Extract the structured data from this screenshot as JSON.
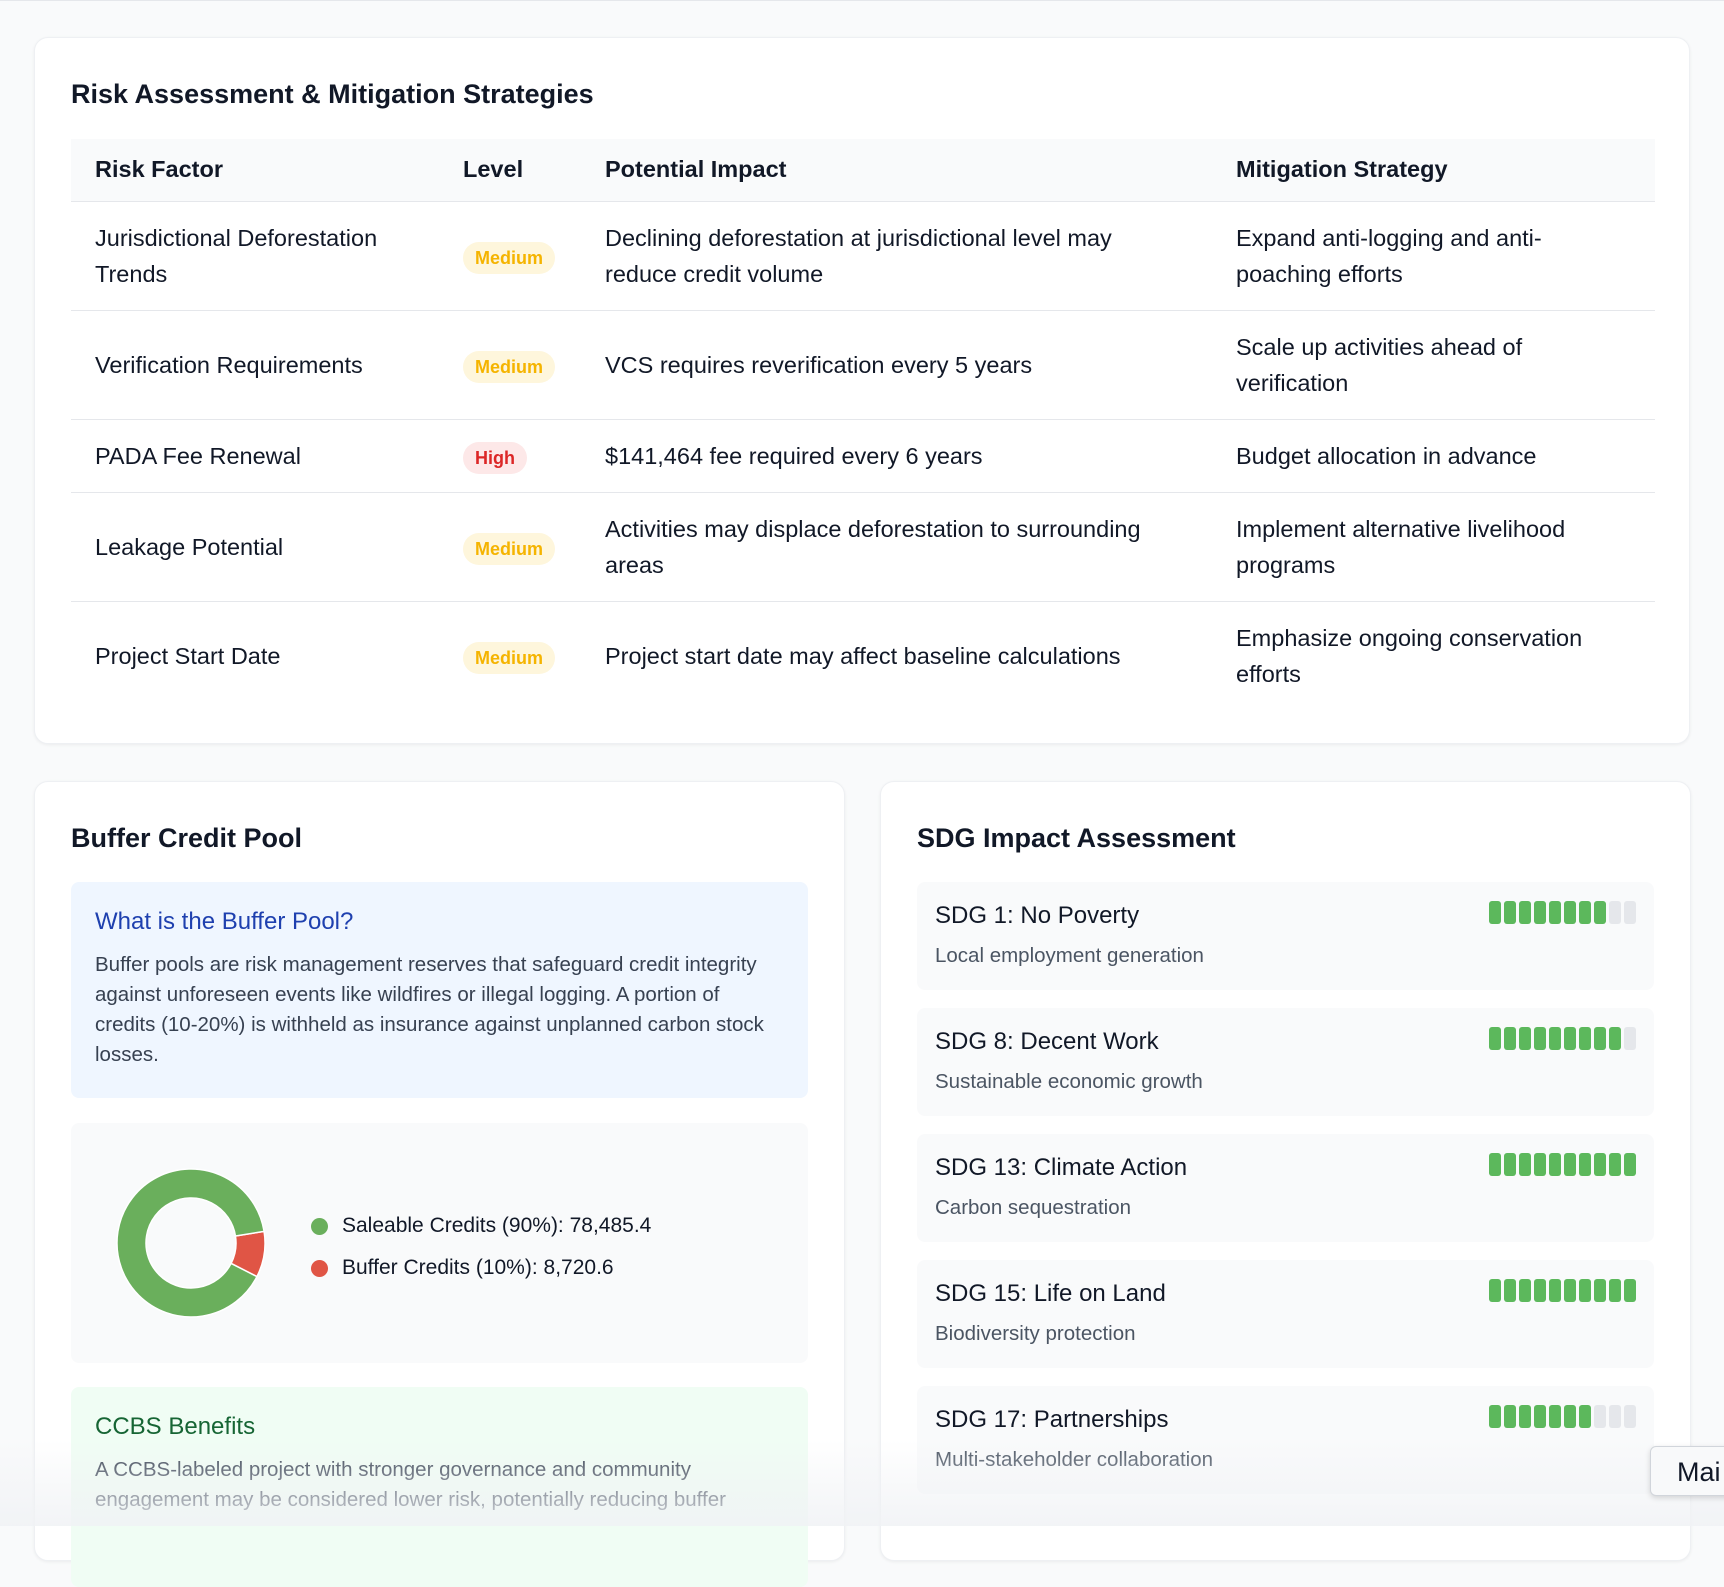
{
  "risk": {
    "title": "Risk Assessment & Mitigation Strategies",
    "headers": [
      "Risk Factor",
      "Level",
      "Potential Impact",
      "Mitigation Strategy"
    ],
    "rows": [
      {
        "factor": "Jurisdictional Deforestation Trends",
        "level": "Medium",
        "impact": "Declining deforestation at jurisdictional level may reduce credit volume",
        "mitigation": "Expand anti-logging and anti-poaching efforts"
      },
      {
        "factor": "Verification Requirements",
        "level": "Medium",
        "impact": "VCS requires reverification every 5 years",
        "mitigation": "Scale up activities ahead of verification"
      },
      {
        "factor": "PADA Fee Renewal",
        "level": "High",
        "impact": "$141,464 fee required every 6 years",
        "mitigation": "Budget allocation in advance"
      },
      {
        "factor": "Leakage Potential",
        "level": "Medium",
        "impact": "Activities may displace deforestation to surrounding areas",
        "mitigation": "Implement alternative livelihood programs"
      },
      {
        "factor": "Project Start Date",
        "level": "Medium",
        "impact": "Project start date may affect baseline calculations",
        "mitigation": "Emphasize ongoing conservation efforts"
      }
    ]
  },
  "buffer": {
    "title": "Buffer Credit Pool",
    "info_title": "What is the Buffer Pool?",
    "info_text": "Buffer pools are risk management reserves that safeguard credit integrity against unforeseen events like wildfires or illegal logging. A portion of credits (10-20%) is withheld as insurance against unplanned carbon stock losses.",
    "ccbs_title": "CCBS Benefits",
    "ccbs_text": "A CCBS-labeled project with stronger governance and community engagement may be considered lower risk, potentially reducing buffer"
  },
  "chart_data": {
    "type": "pie",
    "series": [
      {
        "name": "Saleable Credits (90%): 78,485.4",
        "value": 78485.4,
        "color": "#6aaf5c"
      },
      {
        "name": "Buffer Credits (10%): 8,720.6",
        "value": 8720.6,
        "color": "#e05545"
      }
    ]
  },
  "sdg": {
    "title": "SDG Impact Assessment",
    "items": [
      {
        "title": "SDG 1: No Poverty",
        "desc": "Local employment generation",
        "score": 8,
        "max": 10
      },
      {
        "title": "SDG 8: Decent Work",
        "desc": "Sustainable economic growth",
        "score": 9,
        "max": 10
      },
      {
        "title": "SDG 13: Climate Action",
        "desc": "Carbon sequestration",
        "score": 10,
        "max": 10
      },
      {
        "title": "SDG 15: Life on Land",
        "desc": "Biodiversity protection",
        "score": 10,
        "max": 10
      },
      {
        "title": "SDG 17: Partnerships",
        "desc": "Multi-stakeholder collaboration",
        "score": 7,
        "max": 10
      }
    ]
  },
  "tooltip": {
    "text": "Mai"
  },
  "colors": {
    "on": "#5cb85c",
    "off": "#e5e7eb"
  }
}
